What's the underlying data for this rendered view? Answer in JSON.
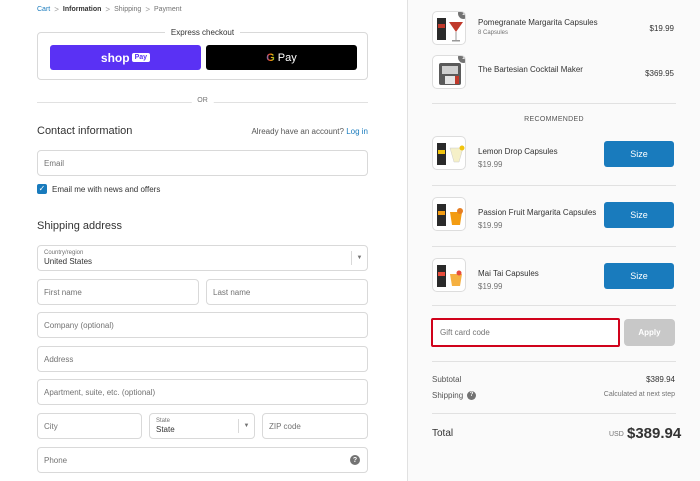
{
  "breadcrumb": {
    "cart": "Cart",
    "information": "Information",
    "shipping": "Shipping",
    "payment": "Payment",
    "separator": ">"
  },
  "express": {
    "title": "Express checkout",
    "shop_label": "shop",
    "shop_pay": "Pay",
    "gpay_g": "G",
    "gpay_label": "Pay"
  },
  "or_label": "OR",
  "contact": {
    "title": "Contact information",
    "account_prompt": "Already have an account?",
    "login": "Log in",
    "email_placeholder": "Email",
    "newsletter_label": "Email me with news and offers",
    "newsletter_checked": true
  },
  "shipping": {
    "title": "Shipping address",
    "country_label": "Country/region",
    "country_value": "United States",
    "first_name": "First name",
    "last_name": "Last name",
    "company": "Company (optional)",
    "address": "Address",
    "apartment": "Apartment, suite, etc. (optional)",
    "city": "City",
    "state_label": "State",
    "state_value": "State",
    "zip": "ZIP code",
    "phone": "Phone"
  },
  "cart": {
    "items": [
      {
        "name": "Pomegranate Margarita Capsules",
        "sub": "8 Capsules",
        "price": "$19.99",
        "qty": "1"
      },
      {
        "name": "The Bartesian Cocktail Maker",
        "sub": "",
        "price": "$369.95",
        "qty": "1"
      }
    ]
  },
  "recommended": {
    "title": "RECOMMENDED",
    "button_label": "Size",
    "items": [
      {
        "name": "Lemon Drop Capsules",
        "price": "$19.99"
      },
      {
        "name": "Passion Fruit Margarita Capsules",
        "price": "$19.99"
      },
      {
        "name": "Mai Tai Capsules",
        "price": "$19.99"
      }
    ]
  },
  "gift": {
    "placeholder": "Gift card code",
    "apply": "Apply"
  },
  "summary": {
    "subtotal_label": "Subtotal",
    "subtotal_value": "$389.94",
    "shipping_label": "Shipping",
    "shipping_value": "Calculated at next step",
    "total_label": "Total",
    "currency": "USD",
    "total_value": "$389.94"
  },
  "colors": {
    "accent": "#197bbd",
    "shop_pay": "#5a31f4",
    "gift_highlight": "#d0021b"
  }
}
